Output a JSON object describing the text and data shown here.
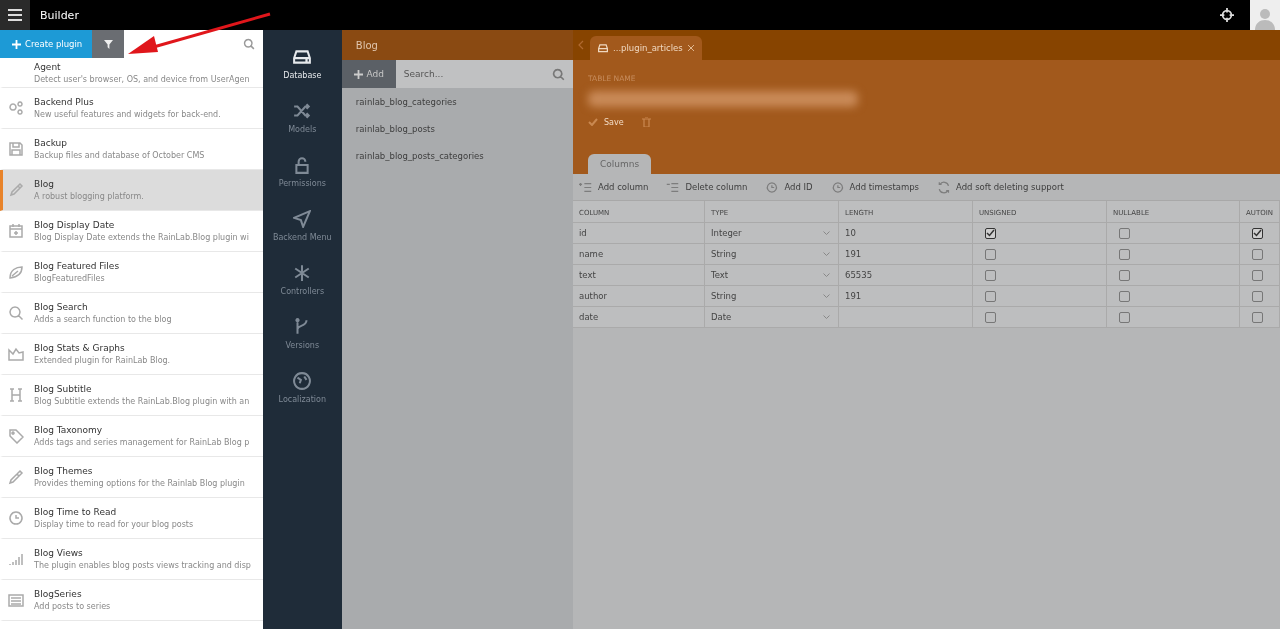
{
  "topbar": {
    "title": "Builder"
  },
  "plugins": {
    "create_button": "Create plugin",
    "items": [
      {
        "title": "Agent",
        "description": "Detect user's browser, OS, and device from UserAgen",
        "selected": false
      },
      {
        "title": "Backend Plus",
        "description": "New useful features and widgets for back-end.",
        "selected": false
      },
      {
        "title": "Backup",
        "description": "Backup files and database of October CMS",
        "selected": false
      },
      {
        "title": "Blog",
        "description": "A robust blogging platform.",
        "selected": true
      },
      {
        "title": "Blog Display Date",
        "description": "Blog Display Date extends the RainLab.Blog plugin wi",
        "selected": false
      },
      {
        "title": "Blog Featured Files",
        "description": "BlogFeaturedFiles",
        "selected": false
      },
      {
        "title": "Blog Search",
        "description": "Adds a search function to the blog",
        "selected": false
      },
      {
        "title": "Blog Stats & Graphs",
        "description": "Extended plugin for RainLab Blog.",
        "selected": false
      },
      {
        "title": "Blog Subtitle",
        "description": "Blog Subtitle extends the RainLab.Blog plugin with an",
        "selected": false
      },
      {
        "title": "Blog Taxonomy",
        "description": "Adds tags and series management for RainLab Blog p",
        "selected": false
      },
      {
        "title": "Blog Themes",
        "description": "Provides theming options for the Rainlab Blog plugin",
        "selected": false
      },
      {
        "title": "Blog Time to Read",
        "description": "Display time to read for your blog posts",
        "selected": false
      },
      {
        "title": "Blog Views",
        "description": "The plugin enables blog posts views tracking and disp",
        "selected": false
      },
      {
        "title": "BlogSeries",
        "description": "Add posts to series",
        "selected": false
      }
    ]
  },
  "nav": [
    {
      "label": "Database",
      "selected": true
    },
    {
      "label": "Models",
      "selected": false
    },
    {
      "label": "Permissions",
      "selected": false
    },
    {
      "label": "Backend Menu",
      "selected": false
    },
    {
      "label": "Controllers",
      "selected": false
    },
    {
      "label": "Versions",
      "selected": false
    },
    {
      "label": "Localization",
      "selected": false
    }
  ],
  "tables_panel": {
    "title": "Blog",
    "add_button": "Add",
    "search_placeholder": "Search...",
    "items": [
      "rainlab_blog_categories",
      "rainlab_blog_posts",
      "rainlab_blog_posts_categories"
    ]
  },
  "editor": {
    "tab": "...plugin_articles",
    "table_name_label": "TABLE NAME",
    "save": "Save",
    "section_tab": "Columns",
    "toolbar": [
      "Add column",
      "Delete column",
      "Add ID",
      "Add timestamps",
      "Add soft deleting support"
    ],
    "columns": [
      "COLUMN",
      "TYPE",
      "LENGTH",
      "UNSIGNED",
      "NULLABLE",
      "AUTOIN"
    ],
    "rows": [
      {
        "column": "id",
        "type": "Integer",
        "length": "10",
        "unsigned": true,
        "nullable": false,
        "autoincrement": true
      },
      {
        "column": "name",
        "type": "String",
        "length": "191",
        "unsigned": false,
        "nullable": false,
        "autoincrement": false
      },
      {
        "column": "text",
        "type": "Text",
        "length": "65535",
        "unsigned": false,
        "nullable": false,
        "autoincrement": false
      },
      {
        "column": "author",
        "type": "String",
        "length": "191",
        "unsigned": false,
        "nullable": false,
        "autoincrement": false
      },
      {
        "column": "date",
        "type": "Date",
        "unsigned": false,
        "nullable": false,
        "autoincrement": false
      }
    ]
  }
}
